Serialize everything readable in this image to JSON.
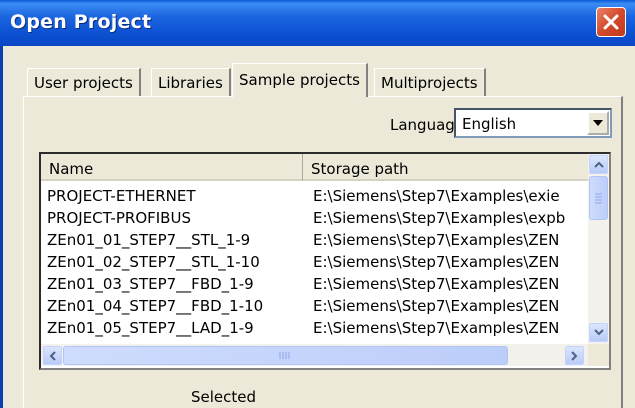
{
  "window": {
    "title": "Open Project"
  },
  "tabs": [
    {
      "label": "User projects",
      "active": false
    },
    {
      "label": "Libraries",
      "active": false
    },
    {
      "label": "Sample projects",
      "active": true
    },
    {
      "label": "Multiprojects",
      "active": false
    }
  ],
  "language": {
    "label": "Language",
    "value": "English"
  },
  "list": {
    "columns": [
      "Name",
      "Storage path"
    ],
    "rows": [
      {
        "name": "PROJECT-ETHERNET",
        "path": "E:\\Siemens\\Step7\\Examples\\exie"
      },
      {
        "name": "PROJECT-PROFIBUS",
        "path": "E:\\Siemens\\Step7\\Examples\\expb"
      },
      {
        "name": "ZEn01_01_STEP7__STL_1-9",
        "path": "E:\\Siemens\\Step7\\Examples\\ZEN"
      },
      {
        "name": "ZEn01_02_STEP7__STL_1-10",
        "path": "E:\\Siemens\\Step7\\Examples\\ZEN"
      },
      {
        "name": "ZEn01_03_STEP7__FBD_1-9",
        "path": "E:\\Siemens\\Step7\\Examples\\ZEN"
      },
      {
        "name": "ZEn01_04_STEP7__FBD_1-10",
        "path": "E:\\Siemens\\Step7\\Examples\\ZEN"
      },
      {
        "name": "ZEn01_05_STEP7__LAD_1-9",
        "path": "E:\\Siemens\\Step7\\Examples\\ZEN"
      }
    ]
  },
  "footer": {
    "selected_label": "Selected"
  },
  "icons": {
    "close": "close-icon",
    "dropdown": "chevron-down-icon",
    "scroll_up": "chevron-up-icon",
    "scroll_down": "chevron-down-icon",
    "scroll_left": "chevron-left-icon",
    "scroll_right": "chevron-right-icon"
  },
  "colors": {
    "titlebar": "#0c52d3",
    "close_button": "#d4492b",
    "face": "#ece9d8"
  }
}
